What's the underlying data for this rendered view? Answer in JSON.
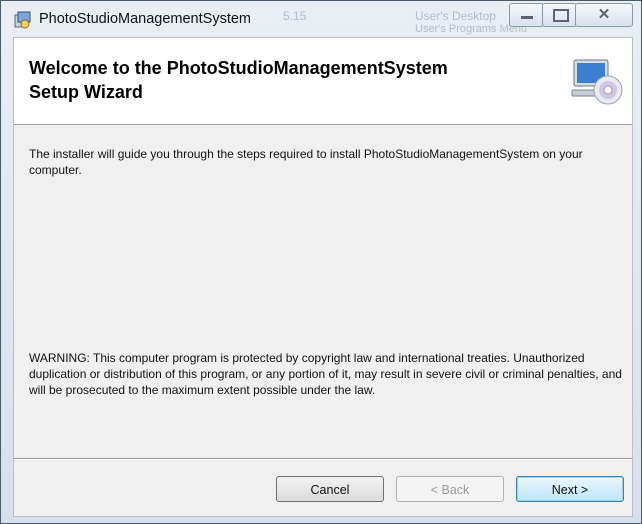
{
  "window": {
    "title": "PhotoStudioManagementSystem"
  },
  "background_ghost": {
    "items": [
      "5.15",
      "User's Desktop",
      "User's Programs Menu"
    ]
  },
  "header": {
    "title_line1": "Welcome to the PhotoStudioManagementSystem",
    "title_line2": "Setup Wizard"
  },
  "body": {
    "intro": "The installer will guide you through the steps required to install PhotoStudioManagementSystem on your computer.",
    "warning": "WARNING: This computer program is protected by copyright law and international treaties. Unauthorized duplication or distribution of this program, or any portion of it, may result in severe civil or criminal penalties, and will be prosecuted to the maximum extent possible under the law."
  },
  "buttons": {
    "cancel": "Cancel",
    "back": "< Back",
    "next": "Next >"
  },
  "icons": {
    "app": "setup-installer-icon",
    "header": "computer-cd-icon"
  }
}
